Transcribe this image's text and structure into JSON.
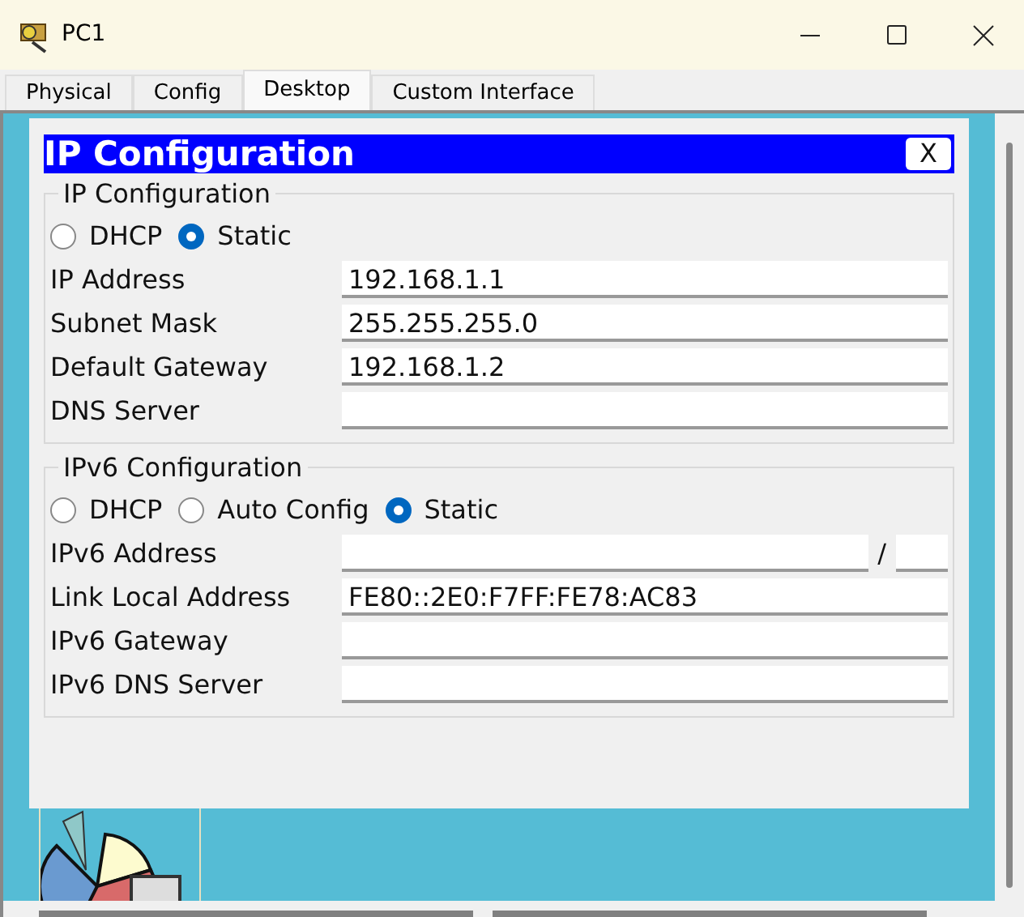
{
  "window": {
    "title": "PC1"
  },
  "tabs": [
    {
      "label": "Physical",
      "selected": false
    },
    {
      "label": "Config",
      "selected": false
    },
    {
      "label": "Desktop",
      "selected": true
    },
    {
      "label": "Custom Interface",
      "selected": false
    }
  ],
  "dialog": {
    "title": "IP Configuration",
    "close": "X",
    "ipv4": {
      "legend": "IP Configuration",
      "modes": [
        {
          "label": "DHCP",
          "selected": false
        },
        {
          "label": "Static",
          "selected": true
        }
      ],
      "fields": [
        {
          "kind": "text",
          "label": "IP Address",
          "value": "192.168.1.1"
        },
        {
          "kind": "text",
          "label": "Subnet Mask",
          "value": "255.255.255.0"
        },
        {
          "kind": "text",
          "label": "Default Gateway",
          "value": "192.168.1.2"
        },
        {
          "kind": "text",
          "label": "DNS Server"
        }
      ]
    },
    "ipv6": {
      "legend": "IPv6 Configuration",
      "modes": [
        {
          "label": "DHCP",
          "selected": false
        },
        {
          "label": "Auto Config",
          "selected": false
        },
        {
          "label": "Static",
          "selected": true
        }
      ],
      "fields": [
        {
          "kind": "prefix",
          "label": "IPv6 Address",
          "separator": "/"
        },
        {
          "kind": "text",
          "label": "Link Local Address",
          "value": "FE80::2E0:F7FF:FE78:AC83"
        },
        {
          "kind": "text",
          "label": "IPv6 Gateway"
        },
        {
          "kind": "text",
          "label": "IPv6 DNS Server"
        }
      ]
    }
  }
}
